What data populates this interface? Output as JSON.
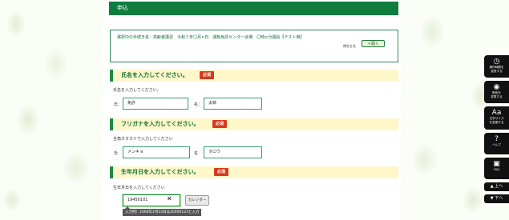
{
  "header": {
    "title": "申込"
  },
  "info": {
    "procedure_label": "選択中の手続き名：",
    "procedure_name": "高齢者講習　令和３年〇月×日　運転免許センター会場　〇時×分開始【テスト用】",
    "inquiry_label": "問合せ先",
    "open_button": "＋開く"
  },
  "sections": {
    "name": {
      "title": "氏名を入力してください。",
      "required": "必須",
      "helper": "氏名を入力してください。",
      "last_label": "氏：",
      "last_value": "免許",
      "first_label": "名：",
      "first_value": "太郎"
    },
    "kana": {
      "title": "フリガナを入力してください。",
      "required": "必須",
      "helper": "全角カタカナで入力してください",
      "last_label": "氏",
      "last_value": "メンキョ",
      "first_label": "名",
      "first_value": "タロウ"
    },
    "birth": {
      "title": "生年月日を入力してください。",
      "required": "必須",
      "helper": "生年月日を入力してください",
      "value": "19450101",
      "calendar_button": "カレンダー",
      "tooltip": "入力例）2000年1月23日は20000123と入力"
    }
  },
  "side": {
    "items": [
      {
        "icon": "clock-icon",
        "glyph": "◷",
        "label1": "操作時間を",
        "label2": "延長する"
      },
      {
        "icon": "palette-icon",
        "glyph": "◉",
        "label1": "配色を",
        "label2": "変更する"
      },
      {
        "icon": "font-size-icon",
        "glyph": "Aa",
        "label1": "文字サイズ",
        "label2": "を変更する"
      },
      {
        "icon": "help-icon",
        "glyph": "?",
        "label1": "ヘルプ",
        "label2": ""
      },
      {
        "icon": "faq-icon",
        "glyph": "▣",
        "label1": "FAQ",
        "label2": ""
      }
    ],
    "scroll_up": "▲ 上へ",
    "scroll_down": "▼ 下へ"
  }
}
